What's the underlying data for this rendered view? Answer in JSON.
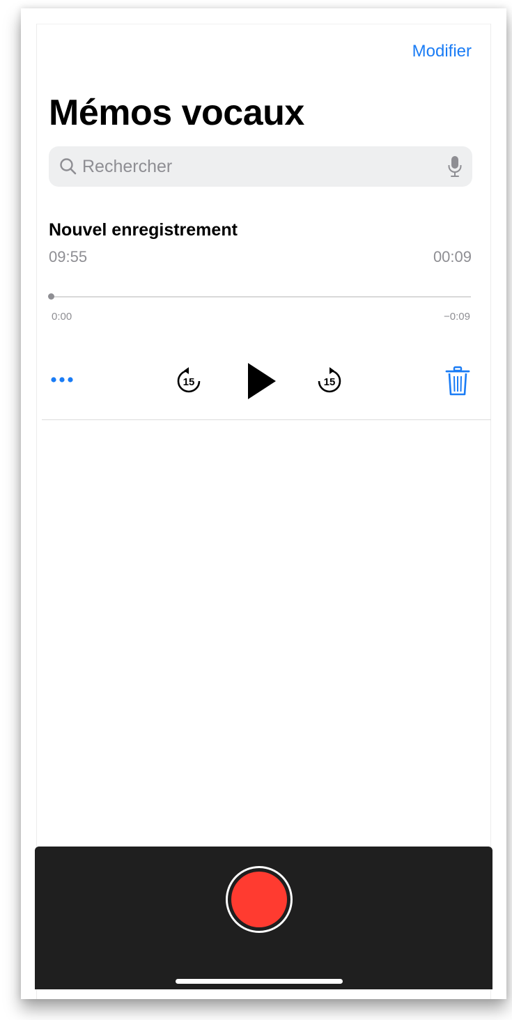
{
  "header": {
    "edit_label": "Modifier",
    "title": "Mémos vocaux"
  },
  "search": {
    "placeholder": "Rechercher",
    "value": ""
  },
  "recording": {
    "name": "Nouvel enregistrement",
    "time": "09:55",
    "duration": "00:09",
    "position_label": "0:00",
    "remaining_label": "−0:09",
    "progress_fraction": 0.0
  },
  "controls": {
    "more_icon": "ellipsis-icon",
    "skip_back_icon": "skip-back-15-icon",
    "skip_back_label": "15",
    "play_icon": "play-icon",
    "skip_forward_icon": "skip-forward-15-icon",
    "skip_forward_label": "15",
    "delete_icon": "trash-icon"
  },
  "colors": {
    "accent": "#1a7cf5",
    "record": "#ff3b30",
    "bar": "#1f1f1f"
  }
}
